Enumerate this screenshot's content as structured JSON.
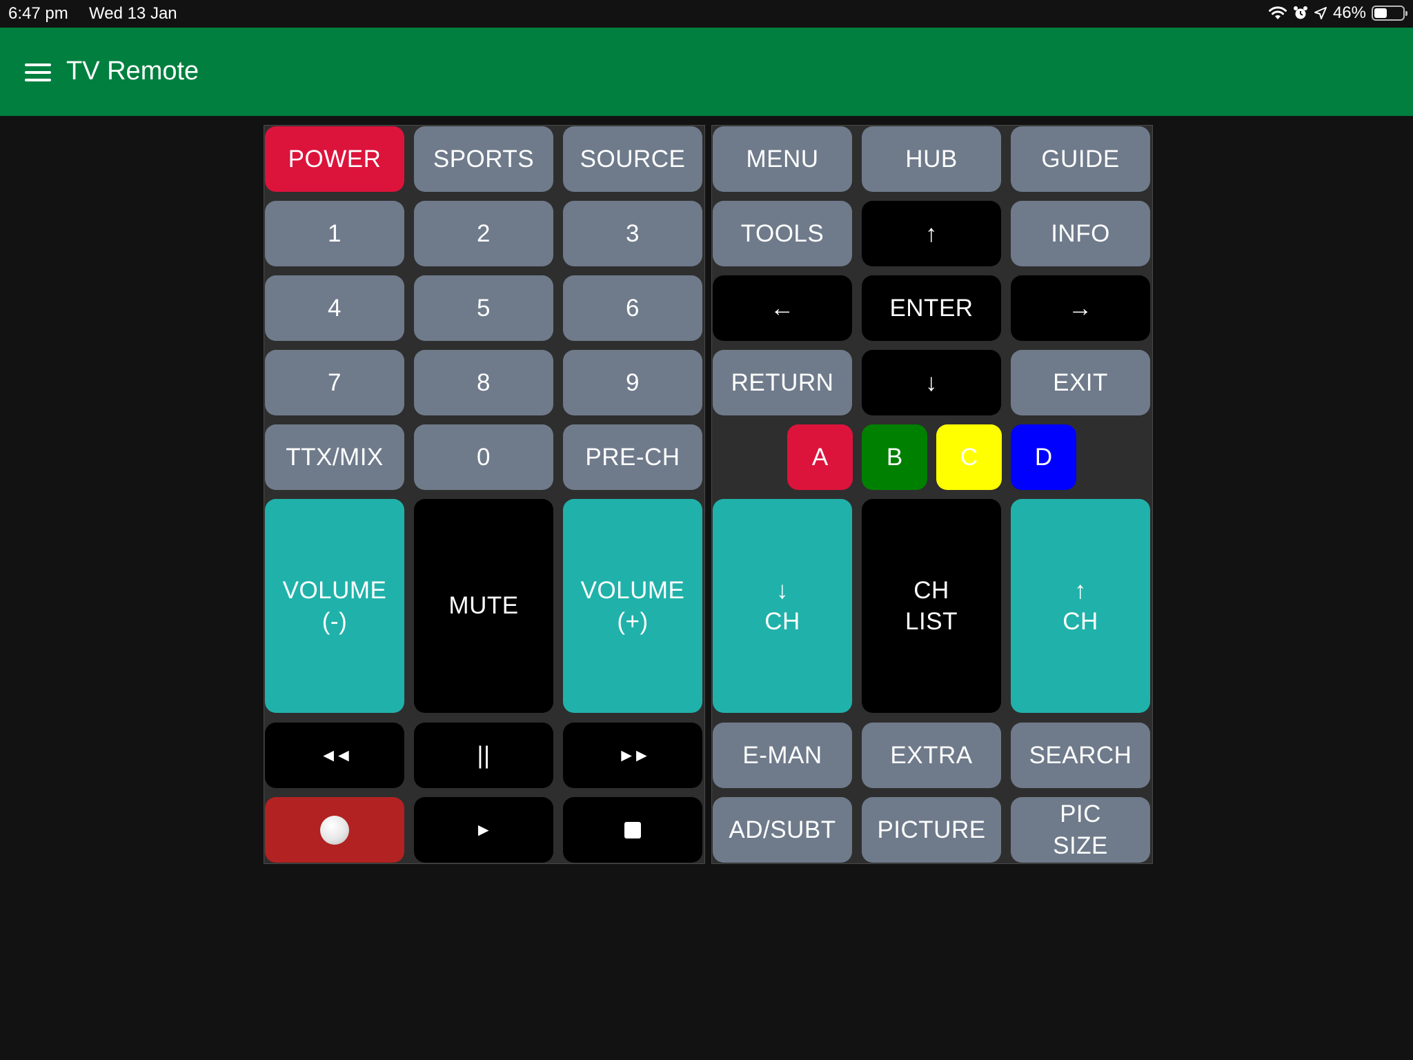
{
  "status_bar": {
    "time": "6:47 pm",
    "date": "Wed 13 Jan",
    "battery": "46%",
    "battery_level": 0.46,
    "icons": [
      "wifi-icon",
      "alarm-icon",
      "location-icon",
      "battery-icon"
    ]
  },
  "app_bar": {
    "title": "TV Remote",
    "menu_icon": "hamburger-menu-icon"
  },
  "left_panel": {
    "power": "POWER",
    "sports": "SPORTS",
    "source": "SOURCE",
    "num1": "1",
    "num2": "2",
    "num3": "3",
    "num4": "4",
    "num5": "5",
    "num6": "6",
    "num7": "7",
    "num8": "8",
    "num9": "9",
    "ttx": "TTX/MIX",
    "num0": "0",
    "prech": "PRE-CH",
    "vol_down": "VOLUME\n(-)",
    "mute": "MUTE",
    "vol_up": "VOLUME\n(+)",
    "rewind": "◄◄",
    "pause": "||",
    "fast_forward": "►►",
    "record_icon": "record-icon",
    "play": "►",
    "stop_icon": "stop-icon"
  },
  "right_panel": {
    "menu": "MENU",
    "hub": "HUB",
    "guide": "GUIDE",
    "tools": "TOOLS",
    "up": "↑",
    "info": "INFO",
    "left": "←",
    "enter": "ENTER",
    "right": "→",
    "return": "RETURN",
    "down": "↓",
    "exit": "EXIT",
    "color_a": "A",
    "color_b": "B",
    "color_c": "C",
    "color_d": "D",
    "ch_down": "↓\nCH",
    "ch_list": "CH\nLIST",
    "ch_up": "↑\nCH",
    "eman": "E-MAN",
    "extra": "EXTRA",
    "search": "SEARCH",
    "adsubt": "AD/SUBT",
    "picture": "PICTURE",
    "picsize": "PIC\nSIZE"
  },
  "colors": {
    "app_bar": "#007f3f",
    "button_gray": "#6f7b8b",
    "power_red": "#dc143c",
    "teal": "#20b2aa",
    "record_red": "#b22222",
    "a_red": "#dc143c",
    "b_green": "#008000",
    "c_yellow": "#ffff00",
    "d_blue": "#0000ff"
  }
}
